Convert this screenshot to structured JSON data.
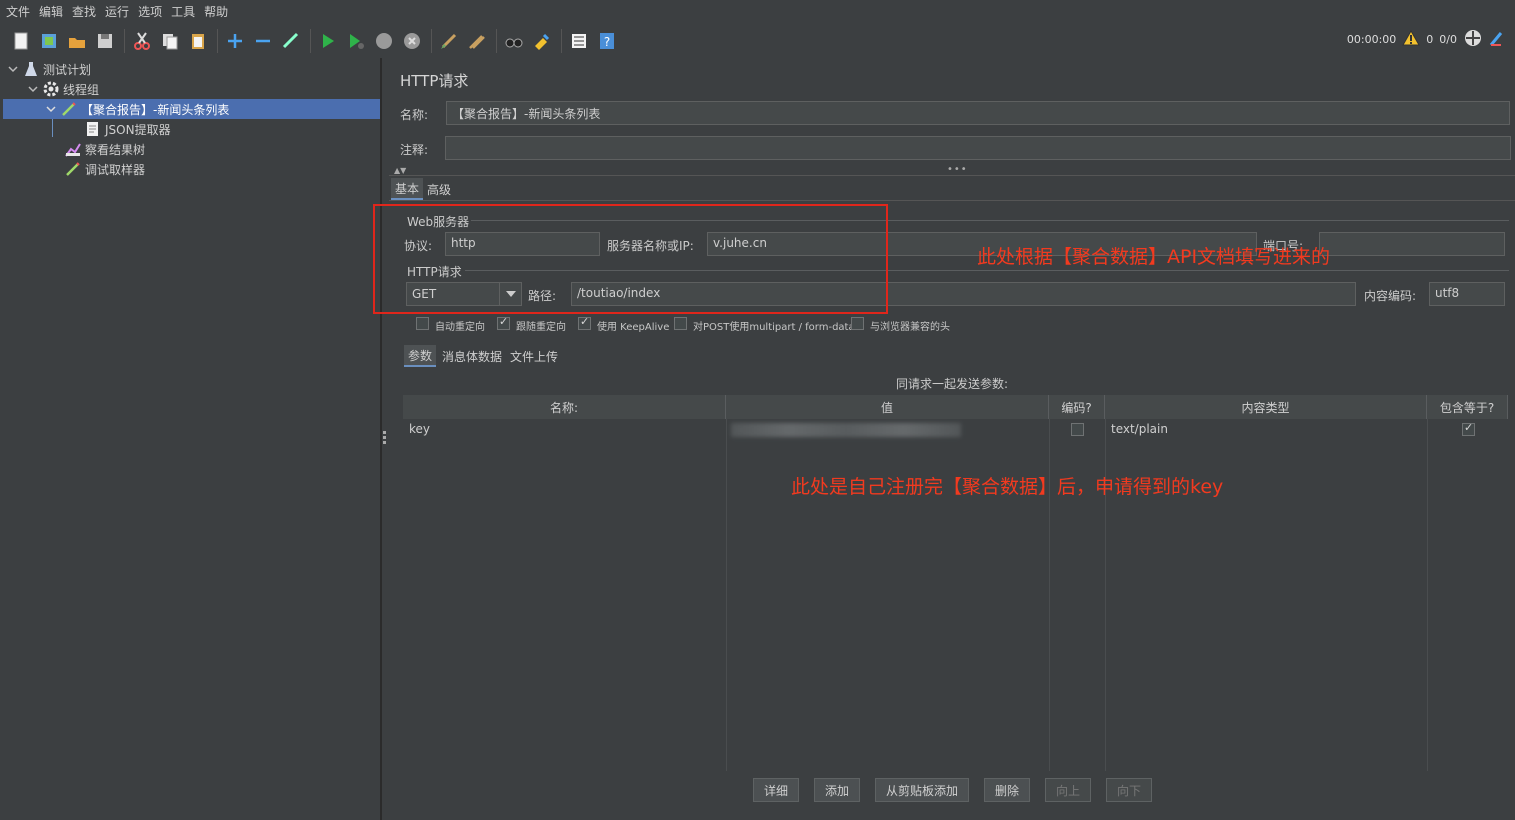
{
  "menu": [
    "文件",
    "编辑",
    "查找",
    "运行",
    "选项",
    "工具",
    "帮助"
  ],
  "toolbar": {
    "icons": [
      "new-icon",
      "templates-icon",
      "open-icon",
      "save-icon",
      "cut-icon",
      "copy-icon",
      "paste-icon",
      "expand-icon",
      "collapse-icon",
      "toggle-icon",
      "start-icon",
      "start-no-pause-icon",
      "stop-icon",
      "shutdown-icon",
      "clear-icon",
      "clear-all-icon",
      "search-icon",
      "reset-search-icon",
      "function-helper-icon",
      "help-icon"
    ],
    "timer": "00:00:00",
    "warning_count": "0",
    "threads": "0/0"
  },
  "tree": {
    "items": [
      {
        "label": "测试计划"
      },
      {
        "label": "线程组"
      },
      {
        "label": "【聚合报告】-新闻头条列表"
      },
      {
        "label": "JSON提取器"
      },
      {
        "label": "察看结果树"
      },
      {
        "label": "调试取样器"
      }
    ]
  },
  "panel": {
    "title": "HTTP请求",
    "name_label": "名称:",
    "name_value": "【聚合报告】-新闻头条列表",
    "comment_label": "注释:",
    "comment_value": "",
    "tabs": [
      "基本",
      "高级"
    ],
    "web_server_group": "Web服务器",
    "protocol_label": "协议:",
    "protocol_value": "http",
    "server_label": "服务器名称或IP:",
    "server_value": "v.juhe.cn",
    "port_label": "端口号:",
    "port_value": "",
    "http_request_group": "HTTP请求",
    "method_value": "GET",
    "path_label": "路径:",
    "path_value": "/toutiao/index",
    "encoding_label": "内容编码:",
    "encoding_value": "utf8",
    "checkboxes": [
      {
        "label": "自动重定向",
        "checked": false
      },
      {
        "label": "跟随重定向",
        "checked": true
      },
      {
        "label": "使用 KeepAlive",
        "checked": true
      },
      {
        "label": "对POST使用multipart / form-data",
        "checked": false
      },
      {
        "label": "与浏览器兼容的头",
        "checked": false
      }
    ],
    "sub_tabs": [
      "参数",
      "消息体数据",
      "文件上传"
    ],
    "params_caption": "同请求一起发送参数:",
    "table": {
      "headers": [
        "名称:",
        "值",
        "编码?",
        "内容类型",
        "包含等于?"
      ],
      "rows": [
        {
          "name": "key",
          "value": "",
          "encode": false,
          "content_type": "text/plain",
          "include_equals": true
        }
      ]
    },
    "buttons": [
      "详细",
      "添加",
      "从剪贴板添加",
      "删除",
      "向上",
      "向下"
    ]
  },
  "annotations": {
    "top": "此处根据【聚合数据】API文档填写进来的",
    "key": "此处是自己注册完【聚合数据】后，申请得到的key"
  },
  "colors": {
    "background": "#3c3f41",
    "selection": "#4b6eaf",
    "annotation": "#f23a1f"
  }
}
